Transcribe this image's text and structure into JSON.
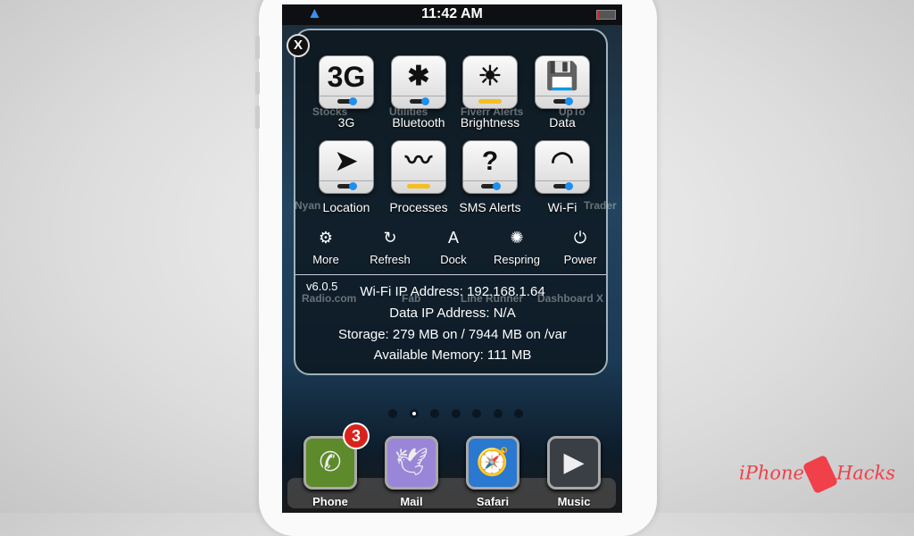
{
  "status_bar": {
    "time": "11:42 AM",
    "carrier_icons": [
      "apple-icon",
      "sbsettings-icon"
    ],
    "battery": "low"
  },
  "background_apps": [
    "Stocks",
    "Utilities",
    "Fiverr Alerts",
    "UpTo",
    "Nyan",
    "Trader",
    "Radio.com",
    "Fab",
    "Line Runner",
    "Dashboard X"
  ],
  "panel": {
    "close_label": "X",
    "toggles": [
      {
        "label": "3G",
        "glyph": "3G",
        "icon": "3g-icon",
        "state": "off"
      },
      {
        "label": "Bluetooth",
        "glyph": "✱",
        "icon": "bluetooth-icon",
        "state": "off"
      },
      {
        "label": "Brightness",
        "glyph": "☀",
        "icon": "brightness-icon",
        "state": "slider"
      },
      {
        "label": "Data",
        "glyph": "💾",
        "icon": "data-icon",
        "state": "off"
      },
      {
        "label": "Location",
        "glyph": "➤",
        "icon": "location-icon",
        "state": "off"
      },
      {
        "label": "Processes",
        "glyph": "〰",
        "icon": "processes-icon",
        "state": "slider"
      },
      {
        "label": "SMS Alerts",
        "glyph": "?",
        "icon": "sms-alerts-icon",
        "state": "off"
      },
      {
        "label": "Wi-Fi",
        "glyph": "◠",
        "icon": "wifi-icon",
        "state": "off"
      }
    ],
    "actions": [
      {
        "label": "More",
        "glyph": "⚙",
        "icon": "gear-icon"
      },
      {
        "label": "Refresh",
        "glyph": "↻",
        "icon": "refresh-icon"
      },
      {
        "label": "Dock",
        "glyph": "A",
        "icon": "dock-icon"
      },
      {
        "label": "Respring",
        "glyph": "✺",
        "icon": "respring-icon"
      },
      {
        "label": "Power",
        "glyph": "⏻",
        "icon": "power-icon"
      }
    ],
    "version": "v6.0.5",
    "info": [
      "Wi-Fi IP Address: 192.168.1.64",
      "Data IP Address: N/A",
      "Storage: 279 MB on / 7944 MB on /var",
      "Available Memory: 111 MB"
    ]
  },
  "page_dots": {
    "count": 7,
    "active": 1
  },
  "dock": [
    {
      "label": "Phone",
      "badge": "3",
      "color": "#5d8a2a"
    },
    {
      "label": "Mail",
      "color": "#9a86d8"
    },
    {
      "label": "Safari",
      "color": "#2a78d0"
    },
    {
      "label": "Music",
      "color": "#3a3f46"
    }
  ],
  "watermark": {
    "left": "iPhone",
    "right": "Hacks",
    "color": "#f0404a"
  }
}
